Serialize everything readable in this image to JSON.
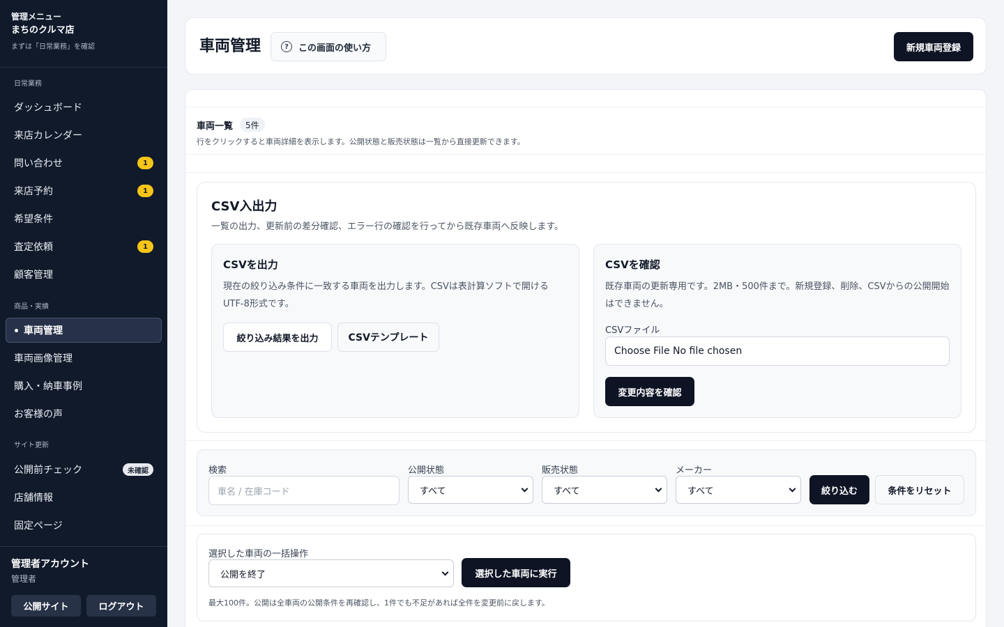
{
  "sidebar": {
    "kicker": "管理メニュー",
    "shop_name": "まちのクルマ店",
    "hint": "まずは「日常業務」を確認",
    "sections": {
      "daily": "日常業務",
      "products": "商品・実績",
      "site": "サイト更新"
    },
    "items": [
      {
        "label": "ダッシュボード",
        "badge": ""
      },
      {
        "label": "来店カレンダー",
        "badge": ""
      },
      {
        "label": "問い合わせ",
        "badge": "1"
      },
      {
        "label": "来店予約",
        "badge": "1"
      },
      {
        "label": "希望条件",
        "badge": ""
      },
      {
        "label": "査定依頼",
        "badge": "1"
      },
      {
        "label": "顧客管理",
        "badge": ""
      },
      {
        "label": "車両管理",
        "badge": "",
        "active": true
      },
      {
        "label": "車両画像管理",
        "badge": ""
      },
      {
        "label": "購入・納車事例",
        "badge": ""
      },
      {
        "label": "お客様の声",
        "badge": ""
      },
      {
        "label": "公開前チェック",
        "badge": "未確認"
      },
      {
        "label": "店舗情報",
        "badge": ""
      },
      {
        "label": "固定ページ",
        "badge": ""
      }
    ],
    "account": {
      "name": "管理者アカウント",
      "role": "管理者",
      "public_site": "公開サイト",
      "logout": "ログアウト"
    }
  },
  "header": {
    "title": "車両管理",
    "help_label": "この画面の使い方",
    "register_label": "新規車両登録"
  },
  "list": {
    "title": "車両一覧",
    "count": "5件",
    "description": "行をクリックすると車両詳細を表示します。公開状態と販売状態は一覧から直接更新できます。"
  },
  "csv": {
    "title": "CSV入出力",
    "description": "一覧の出力、更新前の差分確認、エラー行の確認を行ってから既存車両へ反映します。",
    "export": {
      "title": "CSVを出力",
      "description": "現在の絞り込み条件に一致する車両を出力します。CSVは表計算ソフトで開けるUTF-8形式です。",
      "export_button": "絞り込み結果を出力",
      "template_button": "CSVテンプレート"
    },
    "import": {
      "title": "CSVを確認",
      "description": "既存車両の更新専用です。2MB・500件まで。新規登録、削除、CSVからの公開開始はできません。",
      "file_label": "CSVファイル",
      "file_value": "Choose File No file chosen",
      "confirm_button": "変更内容を確認"
    }
  },
  "filters": {
    "search_label": "検索",
    "search_placeholder": "車名 / 在庫コード",
    "publish_label": "公開状態",
    "publish_value": "すべて",
    "sales_label": "販売状態",
    "sales_value": "すべて",
    "maker_label": "メーカー",
    "maker_value": "すべて",
    "apply_button": "絞り込む",
    "reset_button": "条件をリセット"
  },
  "bulk": {
    "label": "選択した車両の一括操作",
    "action_value": "公開を終了",
    "run_button": "選択した車両に実行",
    "note": "最大100件。公開は全車両の公開条件を再確認し、1件でも不足があれば全件を変更前に戻します。"
  }
}
